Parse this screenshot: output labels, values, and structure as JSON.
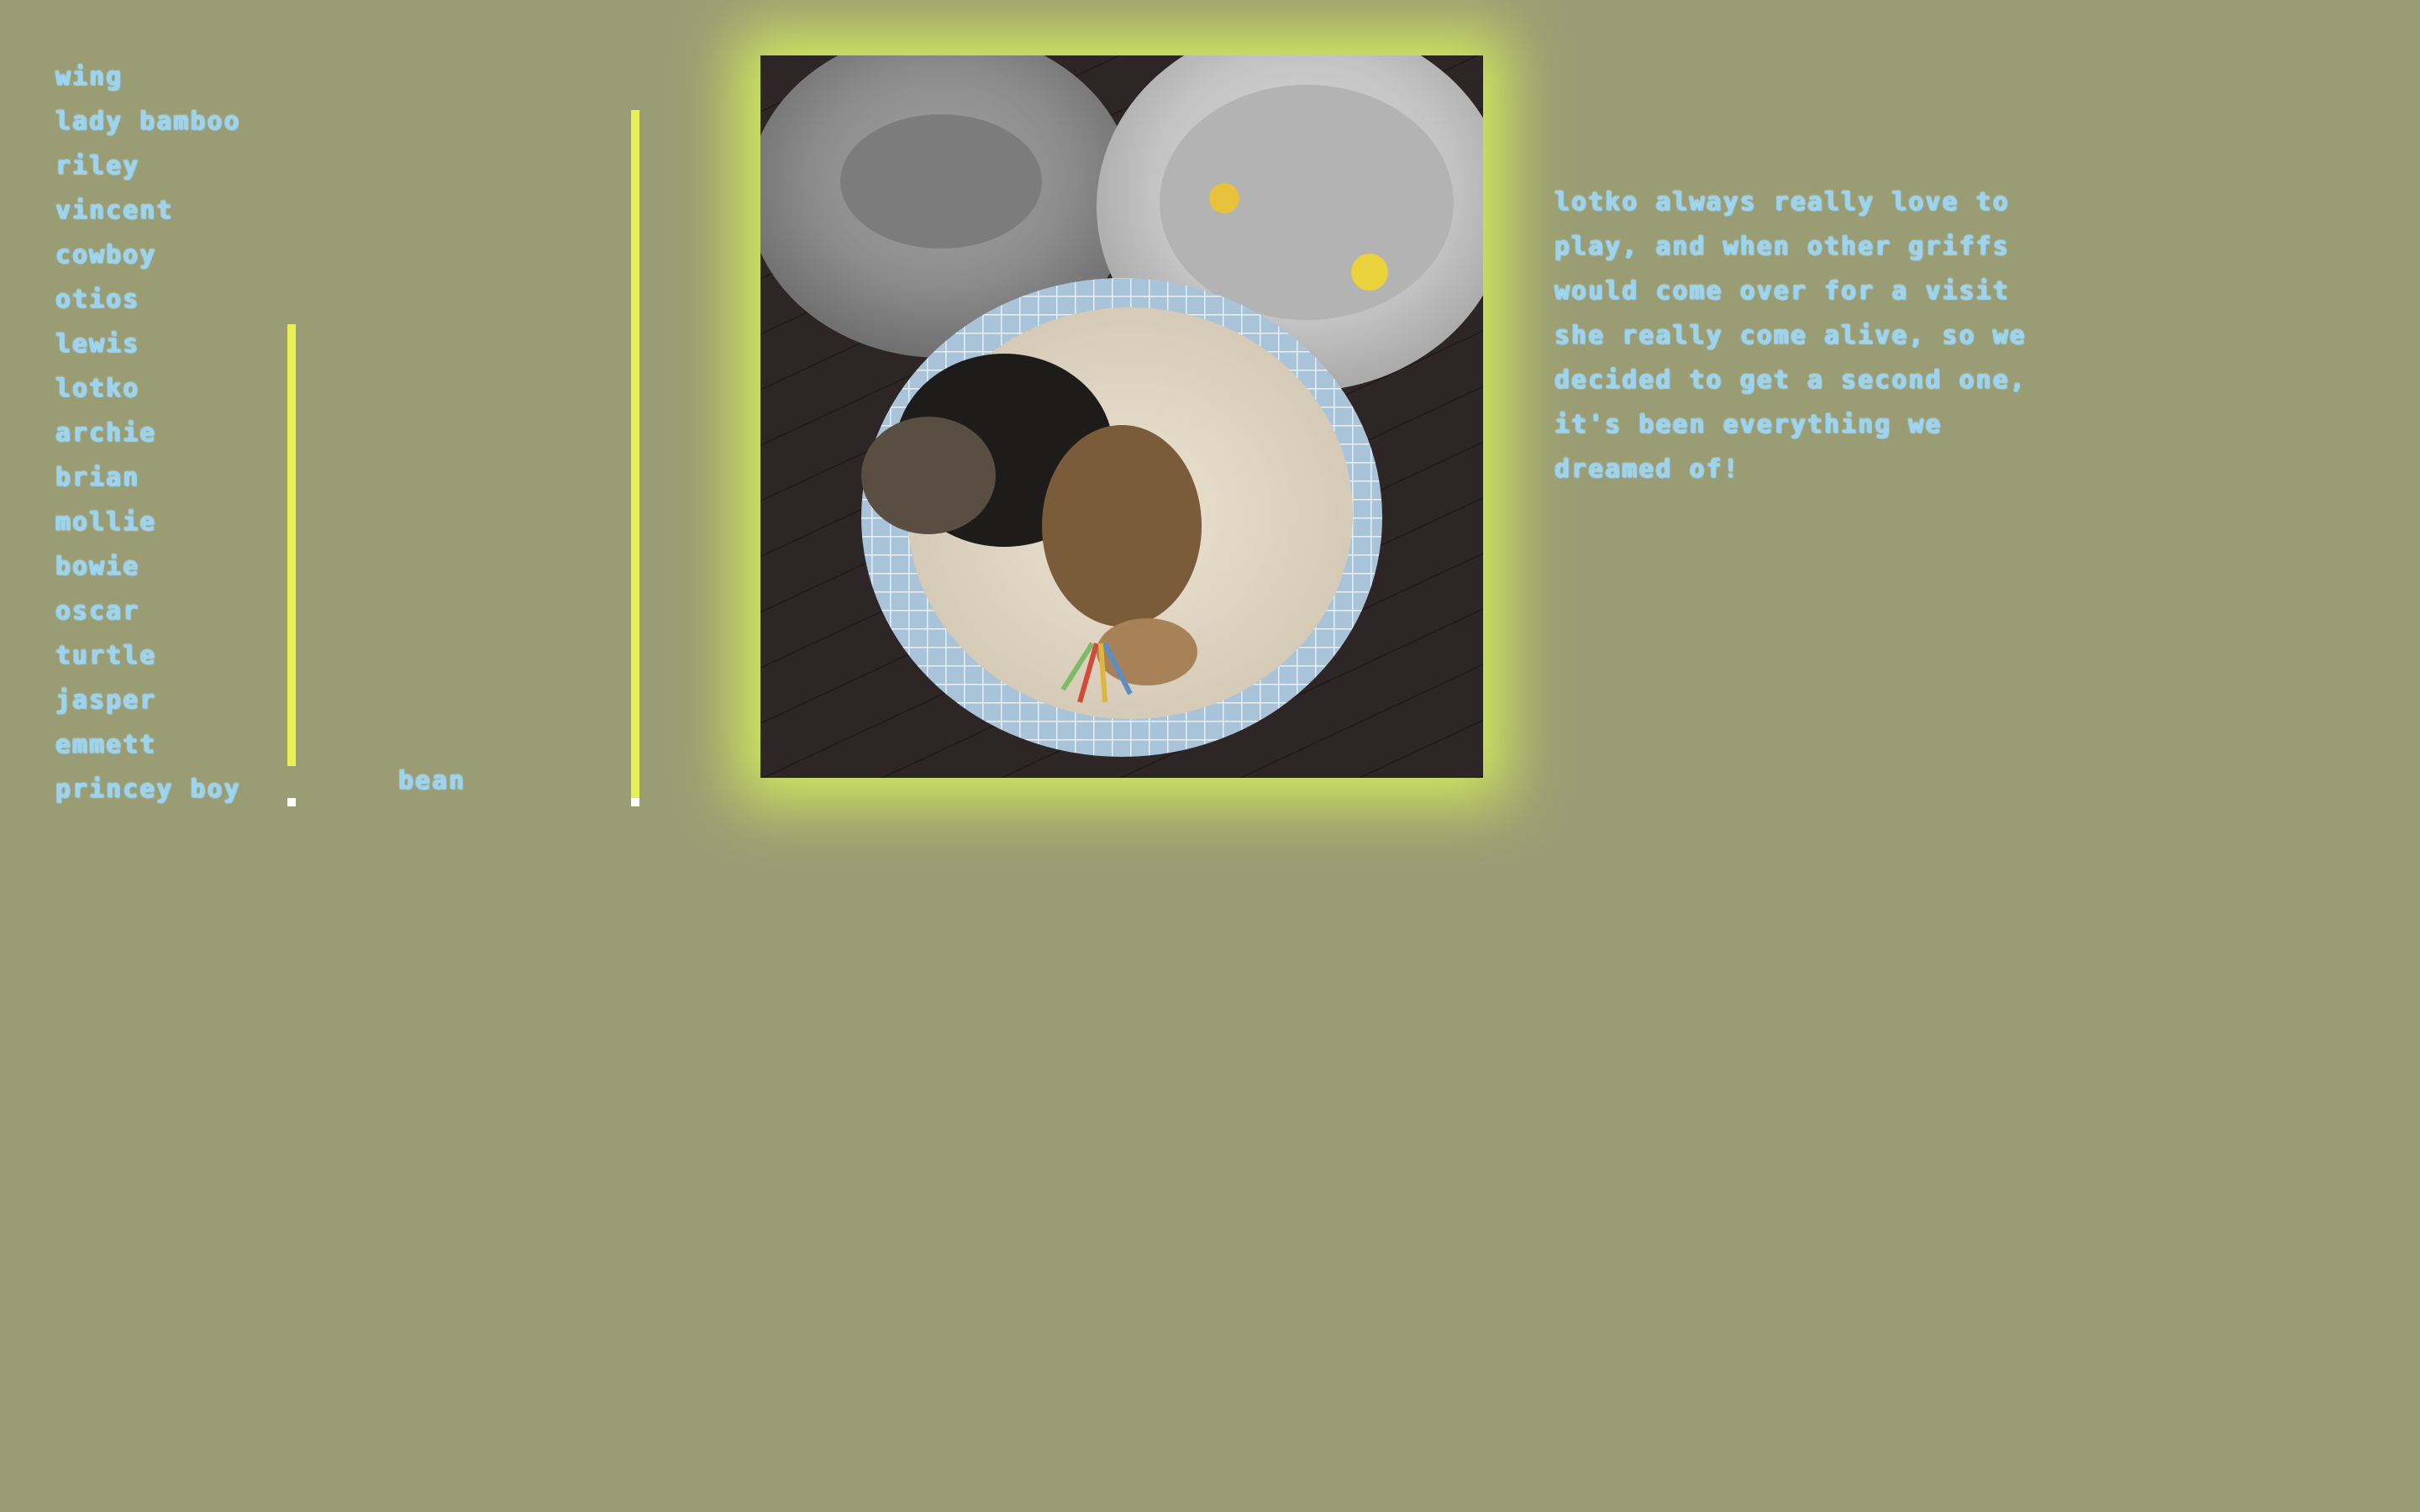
{
  "nav": {
    "items": [
      {
        "label": "wing"
      },
      {
        "label": "lady bamboo"
      },
      {
        "label": "riley"
      },
      {
        "label": "vincent"
      },
      {
        "label": "cowboy"
      },
      {
        "label": "otios"
      },
      {
        "label": "lewis"
      },
      {
        "label": "lotko"
      },
      {
        "label": "archie"
      },
      {
        "label": "brian"
      },
      {
        "label": "mollie"
      },
      {
        "label": "bowie"
      },
      {
        "label": "oscar"
      },
      {
        "label": "turtle"
      },
      {
        "label": "jasper"
      },
      {
        "label": "emmett"
      },
      {
        "label": "princey boy"
      }
    ]
  },
  "side": {
    "name": "bean"
  },
  "story": {
    "text": "lotko always really love to play, and when other griffs would come over for a visit she really come alive, so we decided to get a second one, it's been everything we dreamed of!"
  },
  "photo": {
    "subject": "two puppies sleeping in a round dog bed beside two fluffy grey beds"
  },
  "colors": {
    "background": "#9a9c74",
    "accent": "#e7ef55",
    "glow": "#d2ec5d",
    "text": "#9dd3ec"
  }
}
